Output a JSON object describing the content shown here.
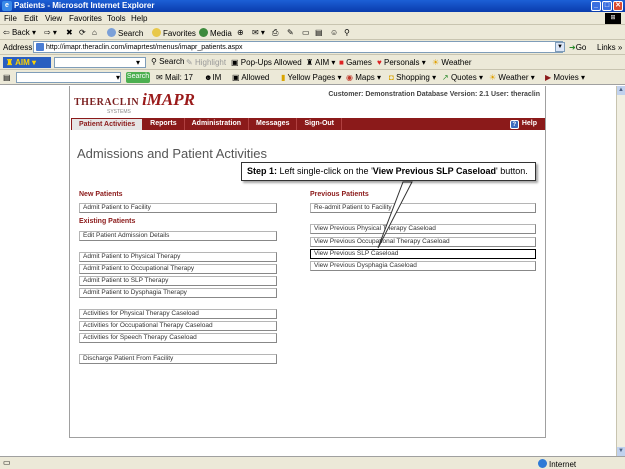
{
  "window": {
    "title": "Patients - Microsoft Internet Explorer",
    "minimize": "_",
    "maximize": "□",
    "close": "✕"
  },
  "menu": [
    "File",
    "Edit",
    "View",
    "Favorites",
    "Tools",
    "Help"
  ],
  "toolbar": {
    "back": "Back",
    "search": "Search",
    "favorites": "Favorites",
    "media": "Media"
  },
  "address": {
    "label": "Address",
    "url": "http://imapr.theraclin.com/imaprtest/menus/imapr_patients.aspx",
    "go": "Go",
    "links": "Links"
  },
  "aim_toolbar": {
    "logo": "AIM",
    "search": "Search",
    "highlight": "Highlight",
    "popups": "Pop-Ups Allowed",
    "aim_menu": "AIM",
    "games": "Games",
    "personals": "Personals",
    "weather": "Weather"
  },
  "search_toolbar": {
    "search_btn": "Search",
    "mail": "Mail: 17",
    "im": "IM",
    "allowed": "Allowed",
    "yellow_pages": "Yellow Pages",
    "maps": "Maps",
    "shopping": "Shopping",
    "quotes": "Quotes",
    "weather": "Weather",
    "movies": "Movies"
  },
  "status": {
    "zone": "Internet"
  },
  "app": {
    "logo_brand": "THERACLIN",
    "logo_product": "iMAPR",
    "logo_sub": "SYSTEMS",
    "customer_info": "Customer: Demonstration Database  Version: 2.1  User: theraclin",
    "nav": [
      {
        "label": "Patient Activities"
      },
      {
        "label": "Reports"
      },
      {
        "label": "Administration"
      },
      {
        "label": "Messages"
      },
      {
        "label": "Sign-Out"
      }
    ],
    "help_icon": "?",
    "help": "Help",
    "page_title": "Admissions and Patient Activities",
    "new_patients": {
      "heading": "New Patients",
      "buttons": [
        "Admit Patient to Facility"
      ]
    },
    "existing_patients": {
      "heading": "Existing Patients",
      "group1": [
        "Edit Patient Admission Details"
      ],
      "group2": [
        "Admit Patient to Physical Therapy",
        "Admit Patient to Occupational Therapy",
        "Admit Patient to SLP Therapy",
        "Admit Patient to Dysphagia Therapy"
      ],
      "group3": [
        "Activities for Physical Therapy Caseload",
        "Activities for Occupational Therapy Caseload",
        "Activities for Speech Therapy Caseload"
      ],
      "group4": [
        "Discharge Patient From Facility"
      ]
    },
    "previous_patients": {
      "heading": "Previous Patients",
      "group1": [
        "Re-admit Patient to Facility"
      ],
      "group2": [
        "View Previous Physical Therapy Caseload",
        "View Previous Occupational Therapy Caseload",
        "View Previous SLP Caseload",
        "View Previous Dysphagia Caseload"
      ]
    }
  },
  "callout": {
    "step": "Step 1:",
    "text_before": " Left single-click on the '",
    "button_name": "View Previous SLP Caseload",
    "text_after": "' button."
  }
}
